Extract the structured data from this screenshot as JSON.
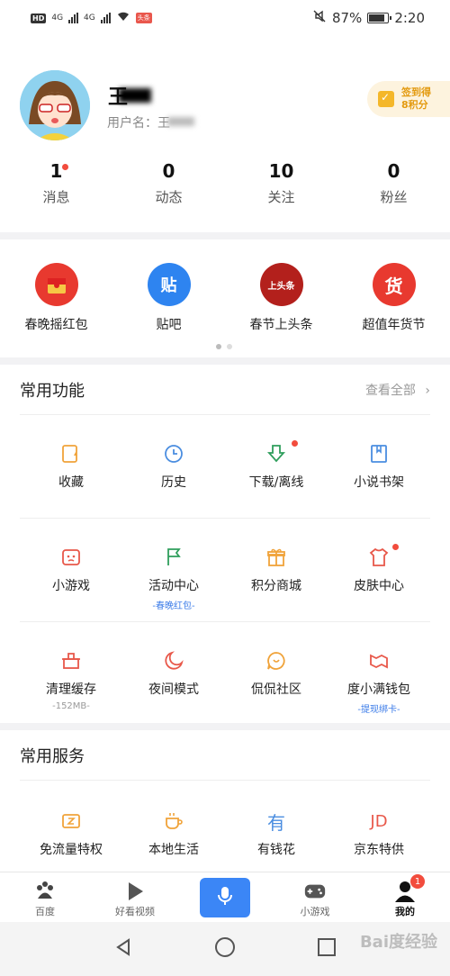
{
  "status_bar": {
    "hd": "HD",
    "net1": "4G",
    "net2": "4G",
    "battery_pct": "87%",
    "battery_fraction": 0.87,
    "time": "2:20",
    "badge": "头条"
  },
  "profile": {
    "username": "王",
    "subname": "用户名：王",
    "checkin_line1": "签到得",
    "checkin_line2": "8积分",
    "stats": [
      {
        "num": "1",
        "label": "消息",
        "dot": true
      },
      {
        "num": "0",
        "label": "动态",
        "dot": false
      },
      {
        "num": "10",
        "label": "关注",
        "dot": false
      },
      {
        "num": "0",
        "label": "粉丝",
        "dot": false
      }
    ]
  },
  "promo": {
    "items": [
      {
        "label": "春晚摇红包",
        "icon": "red-envelope-icon",
        "color": "#e8392f"
      },
      {
        "label": "贴吧",
        "icon": "tieba-icon",
        "color": "#2e84f0",
        "glyph": "贴"
      },
      {
        "label": "春节上头条",
        "icon": "headline-icon",
        "color": "#b3201c",
        "glyph": "上头条"
      },
      {
        "label": "超值年货节",
        "icon": "goods-icon",
        "color": "#e8392f",
        "glyph": "货"
      }
    ]
  },
  "common_functions": {
    "title": "常用功能",
    "more": "查看全部",
    "rows": [
      [
        {
          "label": "收藏",
          "icon": "favorite-icon"
        },
        {
          "label": "历史",
          "icon": "history-icon"
        },
        {
          "label": "下载/离线",
          "icon": "download-icon",
          "dot": true
        },
        {
          "label": "小说书架",
          "icon": "bookshelf-icon"
        }
      ],
      [
        {
          "label": "小游戏",
          "icon": "game-icon"
        },
        {
          "label": "活动中心",
          "icon": "flag-icon",
          "sub": "-春晚红包-"
        },
        {
          "label": "积分商城",
          "icon": "gift-icon"
        },
        {
          "label": "皮肤中心",
          "icon": "skin-icon",
          "dot": true
        }
      ],
      [
        {
          "label": "清理缓存",
          "icon": "clean-icon",
          "sub": "-152MB-"
        },
        {
          "label": "夜间模式",
          "icon": "moon-icon"
        },
        {
          "label": "侃侃社区",
          "icon": "chat-icon"
        },
        {
          "label": "度小满钱包",
          "icon": "wallet-icon",
          "sub": "-提现绑卡-"
        }
      ]
    ]
  },
  "common_services": {
    "title": "常用服务",
    "items": [
      {
        "label": "免流量特权",
        "icon": "data-free-icon"
      },
      {
        "label": "本地生活",
        "icon": "coffee-icon"
      },
      {
        "label": "有钱花",
        "icon": "money-icon",
        "glyph": "有"
      },
      {
        "label": "京东特供",
        "icon": "jd-icon",
        "glyph": "JD"
      }
    ]
  },
  "tabbar": {
    "tabs": [
      {
        "label": "百度",
        "icon": "baidu-paw-icon"
      },
      {
        "label": "好看视频",
        "icon": "play-icon"
      },
      {
        "label": "",
        "icon": "microphone-icon"
      },
      {
        "label": "小游戏",
        "icon": "gamepad-icon"
      },
      {
        "label": "我的",
        "icon": "me-icon",
        "badge": "1"
      }
    ]
  },
  "watermark": "Bai度经验",
  "colors": {
    "accent_blue": "#3b86f6",
    "orange": "#f0a33a",
    "red": "#e8584a",
    "green": "#2f9e5c",
    "blue_icon": "#4a8de0"
  }
}
